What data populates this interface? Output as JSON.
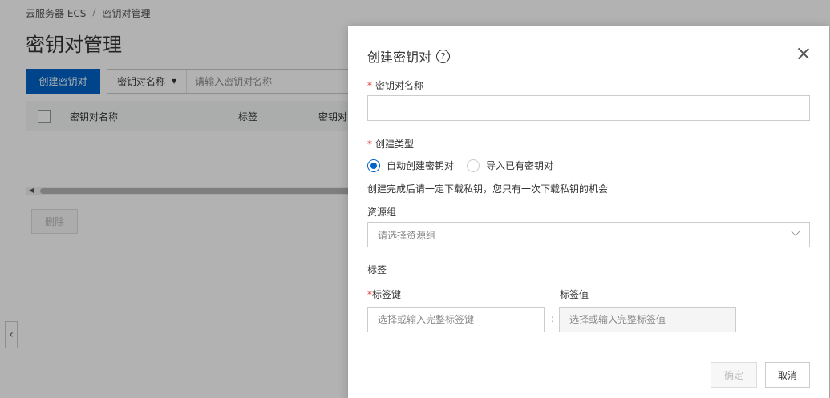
{
  "breadcrumb": {
    "root": "云服务器 ECS",
    "separator": "/",
    "current": "密钥对管理"
  },
  "page": {
    "title": "密钥对管理"
  },
  "toolbar": {
    "create_label": "创建密钥对",
    "filter_field": "密钥对名称",
    "filter_placeholder": "请输入密钥对名称"
  },
  "table": {
    "columns": [
      "密钥对名称",
      "标签",
      "密钥对"
    ],
    "delete_label": "删除"
  },
  "dialog": {
    "title": "创建密钥对",
    "name_label": "密钥对名称",
    "name_value": "",
    "type_label": "创建类型",
    "type_options": [
      "自动创建密钥对",
      "导入已有密钥对"
    ],
    "type_selected": 0,
    "type_hint": "创建完成后请一定下载私钥，您只有一次下载私钥的机会",
    "resource_group_label": "资源组",
    "resource_group_placeholder": "请选择资源组",
    "tags_label": "标签",
    "tag_key_label": "标签键",
    "tag_value_label": "标签值",
    "tag_key_placeholder": "选择或输入完整标签键",
    "tag_value_placeholder": "选择或输入完整标签值",
    "tag_separator": ":",
    "confirm_label": "确定",
    "cancel_label": "取消"
  },
  "colors": {
    "primary": "#0064c8",
    "required": "#d93026",
    "overlay": "rgba(0,0,0,0.3)"
  },
  "icons": [
    "help-circle-icon",
    "close-icon",
    "chevron-down-icon",
    "chevron-left-icon",
    "caret-down-icon"
  ]
}
